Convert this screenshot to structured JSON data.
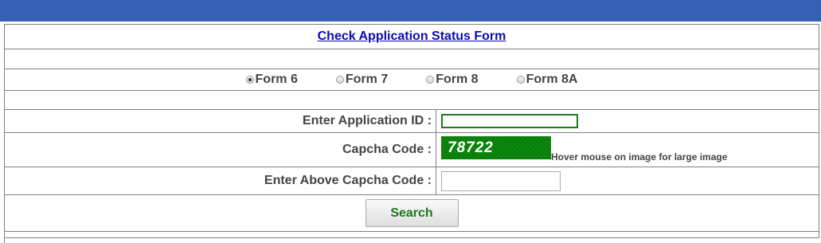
{
  "form": {
    "title": "Check Application Status Form",
    "radio_options": [
      {
        "label": "Form 6",
        "checked": true
      },
      {
        "label": "Form 7",
        "checked": false
      },
      {
        "label": "Form 8",
        "checked": false
      },
      {
        "label": "Form 8A",
        "checked": false
      }
    ],
    "application_id_label": "Enter Application ID :",
    "application_id_value": "",
    "captcha_label": "Capcha Code :",
    "captcha_code": "78722",
    "captcha_hint": "Hover mouse on image for large image",
    "captcha_input_label": "Enter Above Capcha Code :",
    "captcha_input_value": "",
    "search_label": "Search"
  },
  "colors": {
    "top_bar": "#3461b3",
    "title_link": "#0a0ab0",
    "button_text": "#1a7a1a",
    "captcha_bg": "#0a7a0a",
    "grid_border": "#808080"
  }
}
